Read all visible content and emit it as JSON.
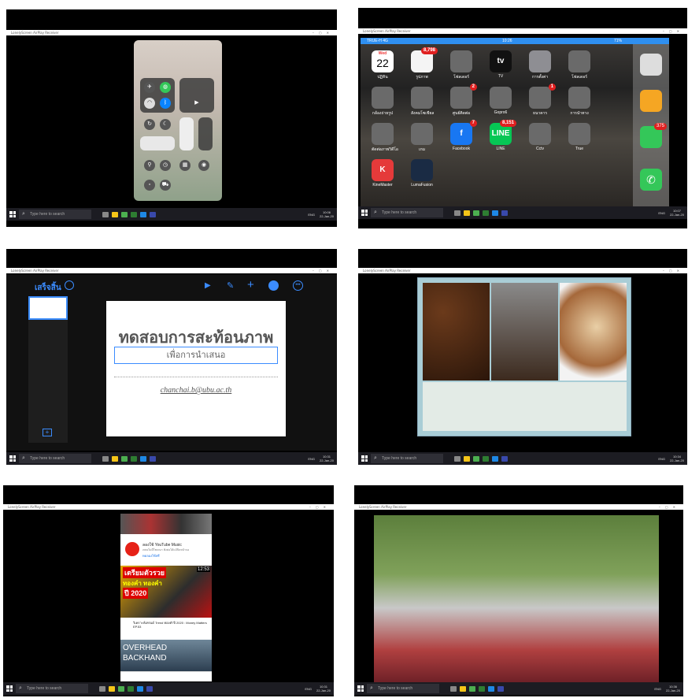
{
  "window_title": "LonelyScreen AirPlay Receiver",
  "taskbar": {
    "search_placeholder": "Type here to search"
  },
  "screens": [
    {
      "clock_time": "10:06",
      "clock_date": "22-Jan-20",
      "tray_lang": "ENG"
    },
    {
      "clock_time": "10:07",
      "clock_date": "22-Jan-20",
      "tray_lang": "ENG",
      "status": {
        "carrier": "TRUE-H 4G",
        "time": "10:26",
        "battery": "71%"
      },
      "calendar_day": "Wed",
      "calendar_date": "22",
      "apps": [
        {
          "label": "ปฏิทิน",
          "color": "#ffffff"
        },
        {
          "label": "รูปภาพ",
          "color": "#f4f4f4",
          "badge": "8,798"
        },
        {
          "label": "โฟลเดอร์",
          "color": "#6a6a6a"
        },
        {
          "label": "TV",
          "color": "#111111",
          "text": "tv"
        },
        {
          "label": "การตั้งค่า",
          "color": "#8e8e93"
        },
        {
          "label": "โฟลเดอร์",
          "color": "#6a6a6a"
        },
        {
          "label": "กล้องถ่ายรูป",
          "color": "#6a6a6a"
        },
        {
          "label": "สังคมโซเชียล",
          "color": "#6a6a6a"
        },
        {
          "label": "ศูนย์ติดต่อ",
          "color": "#6a6a6a",
          "badge": "2"
        },
        {
          "label": "Gopro6",
          "color": "#6a6a6a"
        },
        {
          "label": "ธนาคาร",
          "color": "#6a6a6a",
          "badge": "1"
        },
        {
          "label": "การนำทาง",
          "color": "#6a6a6a"
        },
        {
          "label": "ตัดต่อภาพวิดีโอ",
          "color": "#6a6a6a"
        },
        {
          "label": "เกม",
          "color": "#6a6a6a"
        },
        {
          "label": "Facebook",
          "color": "#1877f2",
          "badge": "7",
          "text": "f"
        },
        {
          "label": "LINE",
          "color": "#06c755",
          "badge": "8,151",
          "text": "LINE"
        },
        {
          "label": "Cctv",
          "color": "#6a6a6a"
        },
        {
          "label": "True",
          "color": "#6a6a6a"
        },
        {
          "label": "KineMaster",
          "color": "#e53a3a",
          "text": "K"
        },
        {
          "label": "LumaFusion",
          "color": "#1a2b44"
        }
      ],
      "dock_badge": "375"
    },
    {
      "clock_time": "10:31",
      "clock_date": "22-Jan-20",
      "tray_lang": "ENG",
      "toolbar": {
        "done": "เสร็จสิ้น"
      },
      "slide_title": "ทดสอบการสะท้อนภาพ",
      "slide_subtitle": "เพื่อการนำเสนอ",
      "slide_email": "chanchai.b@ubu.ac.th"
    },
    {
      "clock_time": "10:34",
      "clock_date": "22-Jan-20",
      "tray_lang": "ENG"
    },
    {
      "clock_time": "10:31",
      "clock_date": "22-Jan-20",
      "tray_lang": "ENG",
      "yt_music": "ลองใช้ YouTube Music",
      "yt_music_sub": "เพลงไม่มีโฆษณา ฟังต่อได้แม้ปิดหน้าจอ",
      "yt_try": "ทดลองใช้ฟรี",
      "thumb_line1": "เตรียมตัวรวย",
      "thumb_line2": "ทองคำ ทองคำ",
      "thumb_line3": "ปี 2020",
      "thumb_time": "12:53",
      "video_title": "วิเคราะห์เทรนด์ Trend ทองคำปี 2020 : Money Matters EP.53",
      "video_banner_1": "OVERHEAD",
      "video_banner_2": "BACKHAND"
    },
    {
      "clock_time": "10:36",
      "clock_date": "22-Jan-20",
      "tray_lang": "ENG"
    }
  ]
}
